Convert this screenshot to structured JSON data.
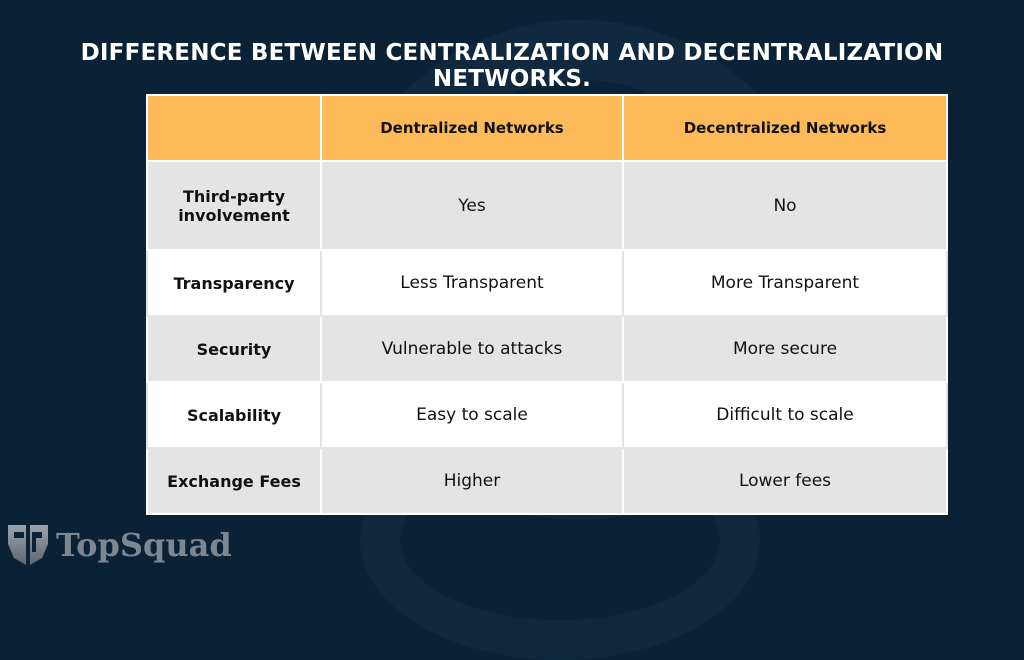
{
  "title": "DIFFERENCE BETWEEN CENTRALIZATION AND DECENTRALIZATION NETWORKS.",
  "table": {
    "headers": [
      "",
      "Dentralized Networks",
      "Decentralized Networks"
    ],
    "rows": [
      {
        "label": "Third-party involvement",
        "centralized": "Yes",
        "decentralized": "No"
      },
      {
        "label": "Transparency",
        "centralized": "Less Transparent",
        "decentralized": "More Transparent"
      },
      {
        "label": "Security",
        "centralized": "Vulnerable to attacks",
        "decentralized": "More secure"
      },
      {
        "label": "Scalability",
        "centralized": "Easy to scale",
        "decentralized": "Difficult to scale"
      },
      {
        "label": "Exchange Fees",
        "centralized": "Higher",
        "decentralized": "Lower fees"
      }
    ]
  },
  "logo": {
    "icon": "ts-shield-icon",
    "text": "TopSquad"
  },
  "colors": {
    "background": "#0b2236",
    "header": "#fcbb58",
    "row_gray": "#e4e4e4",
    "row_white": "#ffffff"
  }
}
